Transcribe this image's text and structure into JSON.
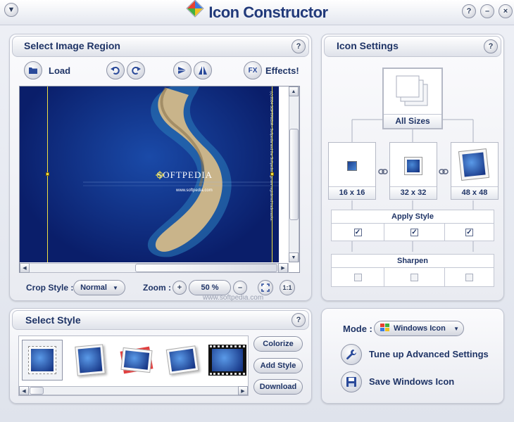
{
  "app": {
    "title": "Icon Constructor"
  },
  "window_buttons": {
    "help": "?",
    "minimize": "–",
    "close": "×"
  },
  "select_region": {
    "title": "Select Image Region",
    "help": "?",
    "load_label": "Load",
    "effects_prefix": "FX",
    "effects_label": "Effects!",
    "crop_style_label": "Crop Style :",
    "crop_style_value": "Normal",
    "zoom_label": "Zoom :",
    "zoom_plus": "+",
    "zoom_value": "50 %",
    "zoom_minus": "–",
    "zoom_one": "1:1",
    "image_text": "SOFTPEDIA",
    "image_url_text": "www.softpedia.com",
    "image_side_text": "(c) 2004 SOFTPEDIA - Softpedia and the Softpedia logo are registered trademarks."
  },
  "icon_settings": {
    "title": "Icon Settings",
    "help": "?",
    "all_sizes_label": "All Sizes",
    "sizes": [
      {
        "label": "16 x 16"
      },
      {
        "label": "32 x 32"
      },
      {
        "label": "48 x 48"
      }
    ],
    "apply_style_label": "Apply Style",
    "apply_style_checks": [
      "✓",
      "✓",
      "✓"
    ],
    "sharpen_label": "Sharpen"
  },
  "select_style": {
    "title": "Select Style",
    "help": "?",
    "colorize_label": "Colorize",
    "add_style_label": "Add Style",
    "download_label": "Download"
  },
  "mode": {
    "label": "Mode :",
    "value": "Windows Icon",
    "tune_label": "Tune up Advanced Settings",
    "save_label": "Save Windows Icon"
  },
  "watermark": "www.softpedia.com",
  "colors": {
    "accent": "#1f3466",
    "image_bg": "#0f2a7a",
    "guide": "#f0e040"
  }
}
